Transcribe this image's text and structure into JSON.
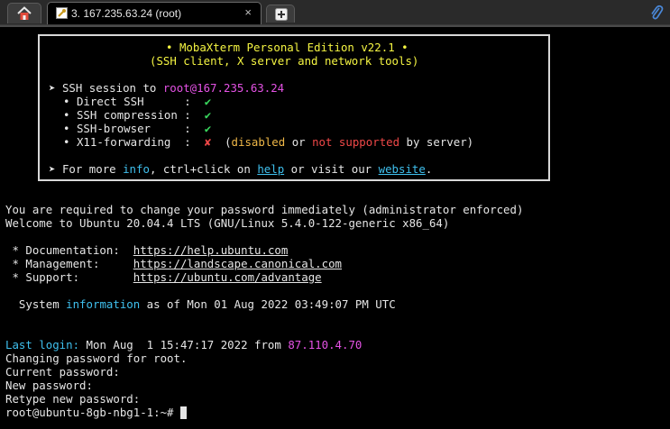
{
  "tabs": {
    "home_icon": "home-icon",
    "session_title": "3. 167.235.63.24 (root)",
    "close_label": "×",
    "new_tab_icon": "plus-icon",
    "attach_icon": "paperclip-icon"
  },
  "banner": {
    "title_bullet_left": "•",
    "title": "MobaXterm Personal Edition v22.1",
    "title_bullet_right": "•",
    "subtitle": "(SSH client, X server and network tools)",
    "session_arrow": "➤",
    "session_prefix": "SSH session to",
    "session_target": "root@167.235.63.24",
    "features": [
      {
        "bullet": "•",
        "label": "Direct SSH      :",
        "mark": "✔"
      },
      {
        "bullet": "•",
        "label": "SSH compression :",
        "mark": "✔"
      },
      {
        "bullet": "•",
        "label": "SSH-browser     :",
        "mark": "✔"
      },
      {
        "bullet": "•",
        "label": "X11-forwarding  :",
        "mark": "✘"
      }
    ],
    "x11_open": "(",
    "x11_disabled": "disabled",
    "x11_or": "or",
    "x11_not_supported": "not supported",
    "x11_tail": "by server)",
    "more_arrow": "➤",
    "more_prefix": "For more",
    "more_info": "info",
    "more_middle": ", ctrl+click on",
    "more_help": "help",
    "more_visit": "or visit our",
    "more_website": "website",
    "more_dot": "."
  },
  "terminal": {
    "line_pw_required": "You are required to change your password immediately (administrator enforced)",
    "line_welcome": "Welcome to Ubuntu 20.04.4 LTS (GNU/Linux 5.4.0-122-generic x86_64)",
    "doc_label": " * Documentation:  ",
    "doc_url": "https://help.ubuntu.com",
    "mgmt_label": " * Management:     ",
    "mgmt_url": "https://landscape.canonical.com",
    "support_label": " * Support:        ",
    "support_url": "https://ubuntu.com/advantage",
    "sysinfo_prefix": "  System ",
    "sysinfo_word": "information",
    "sysinfo_suffix": " as of Mon 01 Aug 2022 03:49:07 PM UTC",
    "last_login_label": "Last login:",
    "last_login_time": " Mon Aug  1 15:47:17 2022 from ",
    "last_login_ip": "87.110.4.70",
    "line_changing": "Changing password for root.",
    "line_current": "Current password:",
    "line_new": "New password:",
    "line_retype": "Retype new password:",
    "prompt": "root@ubuntu-8gb-nbg1-1:~# "
  }
}
